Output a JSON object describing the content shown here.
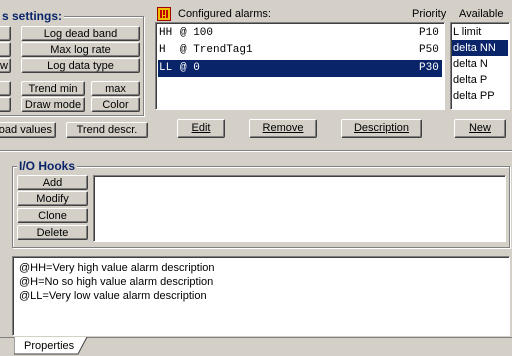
{
  "settings_group": {
    "title": "s settings:",
    "buttons": {
      "log_dead_band": "Log dead band",
      "max_log_rate": "Max log rate",
      "log_data_type": "Log data type",
      "trend_min": "Trend min",
      "max": "max",
      "draw_mode": "Draw mode",
      "color": "Color"
    },
    "left_stub_button": "w"
  },
  "bottom_buttons": {
    "load_values": "oad values",
    "trend_descr": "Trend descr."
  },
  "alarms": {
    "title": "Configured alarms:",
    "priority_header": "Priority",
    "available_header": "Available",
    "rows": [
      {
        "name": "HH",
        "expr": "@ 100",
        "priority": "P10"
      },
      {
        "name": "H",
        "expr": "@ TrendTag1",
        "priority": "P50"
      },
      {
        "name": "LL",
        "expr": "@ 0",
        "priority": "P30"
      }
    ],
    "available": [
      "L limit",
      "delta NN",
      "delta N",
      "delta P",
      "delta PP"
    ],
    "buttons": {
      "edit": "Edit",
      "remove": "Remove",
      "description": "Description",
      "new": "New"
    }
  },
  "io_hooks": {
    "title": "I/O Hooks",
    "buttons": {
      "add": "Add",
      "modify": "Modify",
      "clone": "Clone",
      "delete": "Delete"
    }
  },
  "descriptions": [
    "@HH=Very high value alarm description",
    "@H=No so high value alarm description",
    "@LL=Very low value alarm description"
  ],
  "tab": {
    "label": "Properties"
  },
  "colors": {
    "selection": "#0a246a",
    "face": "#d4d0c8",
    "alarm_icon": "#f0c000"
  }
}
